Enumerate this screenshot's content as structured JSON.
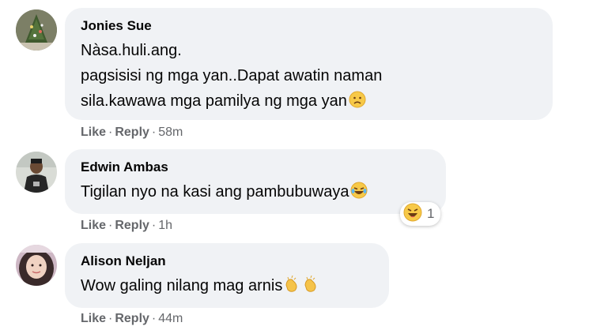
{
  "comments": [
    {
      "author": "Jonies Sue",
      "lines": [
        "Nàsa.huli.ang.",
        "pagsisisi ng mga yan..Dapat awatin naman",
        "sila.kawawa mga pamilya ng mga yan"
      ],
      "emoji": "sad-face-icon",
      "like_label": "Like",
      "reply_label": "Reply",
      "time": "58m"
    },
    {
      "author": "Edwin Ambas",
      "lines": [
        "Tigilan nyo na kasi ang pambubuwaya"
      ],
      "emoji": "laughing-tears-icon",
      "like_label": "Like",
      "reply_label": "Reply",
      "time": "1h",
      "reaction": {
        "icon": "haha-reaction-icon",
        "count": "1"
      }
    },
    {
      "author": "Alison Neljan",
      "lines": [
        "Wow galing nilang mag arnis"
      ],
      "emoji": "clapping-hands-icon",
      "like_label": "Like",
      "reply_label": "Reply",
      "time": "44m"
    }
  ],
  "separator": "·",
  "colors": {
    "bubble": "#f0f2f5",
    "meta_text": "#65676b",
    "body_text": "#050505"
  }
}
